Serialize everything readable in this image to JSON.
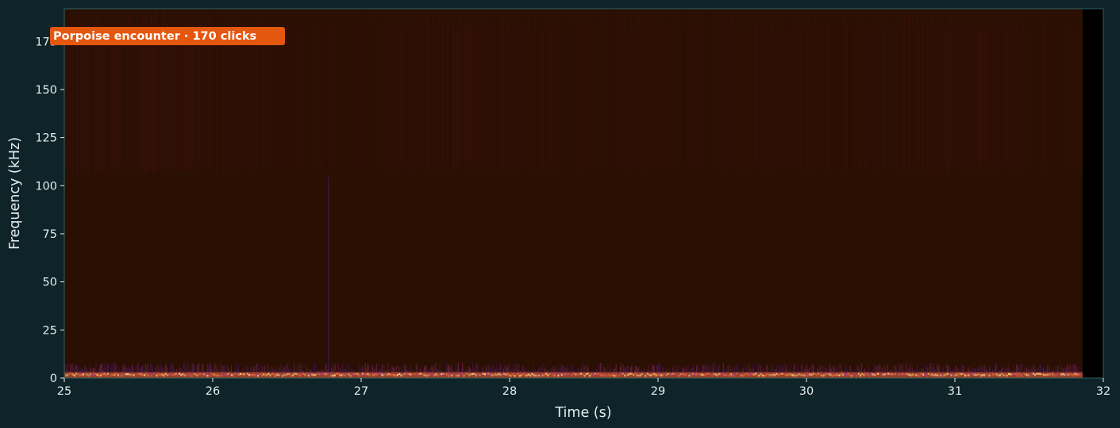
{
  "chart_data": {
    "type": "heatmap",
    "title": "",
    "xlabel": "Time (s)",
    "ylabel": "Frequency (kHz)",
    "xlim": [
      25,
      32
    ],
    "ylim": [
      0,
      192
    ],
    "x_ticks": [
      25,
      26,
      27,
      28,
      29,
      30,
      31,
      32
    ],
    "y_ticks": [
      0,
      25,
      50,
      75,
      100,
      125,
      150,
      175
    ],
    "grid": false,
    "data_end_time": 31.86,
    "colormap": "inferno",
    "annotation": {
      "text": "Porpoise encounter · 170 clicks",
      "position": "top-left"
    },
    "bands": [
      {
        "name": "low-frequency-noise",
        "freq_range": [
          0,
          3
        ],
        "intensity": 0.9
      },
      {
        "name": "low-frequency-fringe",
        "freq_range": [
          3,
          8
        ],
        "intensity": 0.45
      },
      {
        "name": "click-energy-band",
        "freq_range": [
          105,
          192
        ],
        "intensity": 0.2
      }
    ],
    "transients": [
      {
        "time": 26.78,
        "freq_range": [
          0,
          105
        ],
        "intensity": 0.45
      }
    ]
  },
  "colors": {
    "background": "#0e2429",
    "plot_background": "#2a0f03",
    "padding_region": "#000000",
    "axes_edge": "#2e5f66",
    "text": "#e4ecee",
    "badge": "#e4570e",
    "badge_text": "#ffffff",
    "noise_band_hot": "#fcd27a",
    "noise_band_warm": "#f06a3e",
    "noise_band_magenta": "#b23a8f",
    "noise_band_violet": "#5a1ea2",
    "click_striation": "#6e1a28"
  }
}
